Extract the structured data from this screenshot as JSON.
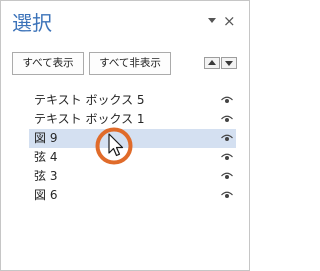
{
  "pane": {
    "title": "選択",
    "options_icon": "chevron-down-icon",
    "close_label": "×"
  },
  "toolbar": {
    "show_all_label": "すべて表示",
    "hide_all_label": "すべて非表示",
    "move_up_icon": "triangle-up-icon",
    "move_down_icon": "triangle-down-icon"
  },
  "objects": [
    {
      "label": "テキスト ボックス 5",
      "visibility_icon": "eye-icon",
      "selected": false
    },
    {
      "label": "テキスト ボックス 1",
      "visibility_icon": "eye-icon",
      "selected": false
    },
    {
      "label": "図 9",
      "visibility_icon": "eye-icon",
      "selected": true
    },
    {
      "label": "弦 4",
      "visibility_icon": "eye-icon",
      "selected": false
    },
    {
      "label": "弦 3",
      "visibility_icon": "eye-icon",
      "selected": false
    },
    {
      "label": "図 6",
      "visibility_icon": "eye-icon",
      "selected": false
    }
  ],
  "colors": {
    "title": "#3c73b9",
    "selection": "#d4e0f1",
    "cursor_highlight": "#e06b2a"
  }
}
